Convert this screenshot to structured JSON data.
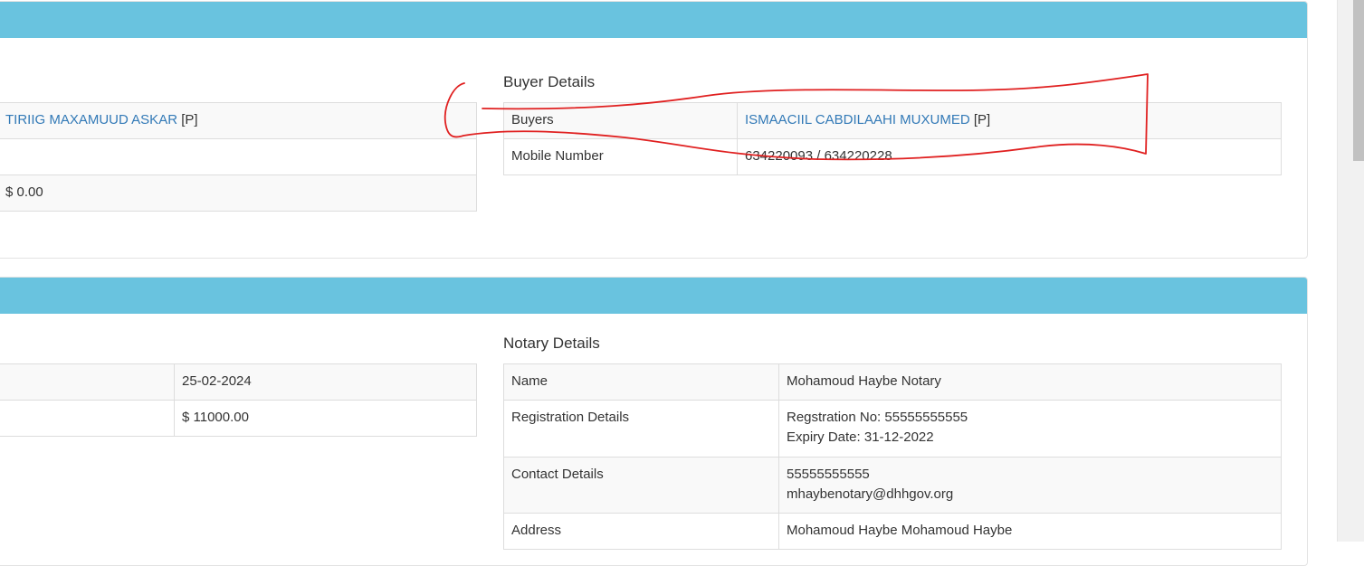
{
  "seller_table": {
    "rows": [
      {
        "value_name": "TIRIIG MAXAMUUD ASKAR",
        "value_suffix": "[P]"
      },
      {
        "value": ""
      },
      {
        "value": "$ 0.00"
      }
    ]
  },
  "buyer": {
    "title": "Buyer Details",
    "rows": [
      {
        "label": "Buyers",
        "value_name": "ISMAACIIL CABDILAAHI MUXUMED",
        "value_suffix": "[P]"
      },
      {
        "label": "Mobile Number",
        "value": "634220093 / 634220228"
      }
    ]
  },
  "transaction_table": {
    "rows": [
      {
        "value": "25-02-2024"
      },
      {
        "value": "$ 11000.00"
      }
    ]
  },
  "notary": {
    "title": "Notary Details",
    "rows": [
      {
        "label": "Name",
        "value1": "Mohamoud Haybe Notary",
        "value2": ""
      },
      {
        "label": "Registration Details",
        "value1": "Regstration No: 55555555555",
        "value2": "Expiry Date: 31-12-2022"
      },
      {
        "label": "Contact Details",
        "value1": "55555555555",
        "value2": "mhaybenotary@dhhgov.org"
      },
      {
        "label": "Address",
        "value1": "Mohamoud Haybe Mohamoud Haybe",
        "value2": ""
      }
    ]
  },
  "colors": {
    "panel_header": "#69c3df",
    "link": "#337ab7",
    "annotation": "#e02020"
  }
}
